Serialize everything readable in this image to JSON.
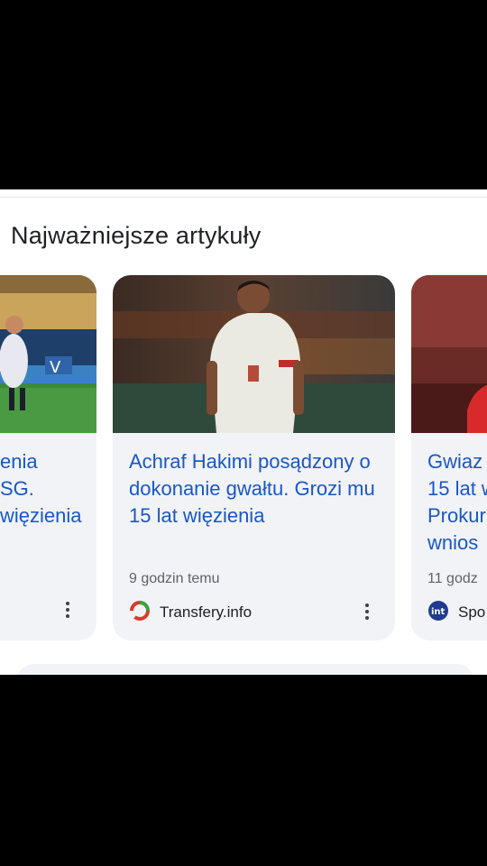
{
  "section": {
    "title": "Najważniejsze artykuły"
  },
  "cards": [
    {
      "headline_lines": [
        "enia",
        "SG.",
        "więzienia"
      ]
    },
    {
      "headline": "Achraf Hakimi posądzony o dokonanie gwałtu. Grozi mu 15 lat więzienia",
      "time": "9 godzin temu",
      "source": "Transfery.info"
    },
    {
      "headline_lines": [
        "Gwiaz",
        "15 lat w",
        "Prokur",
        "wnios"
      ],
      "time": "11 godz",
      "source": "Spo"
    }
  ],
  "icons": {
    "more": "more-vert-icon",
    "transfery": "transfery-logo-icon",
    "sport": "sport-logo-icon"
  },
  "colors": {
    "headline": "#1a57c5",
    "card_bg": "#f1f3f7",
    "title": "#202124"
  }
}
